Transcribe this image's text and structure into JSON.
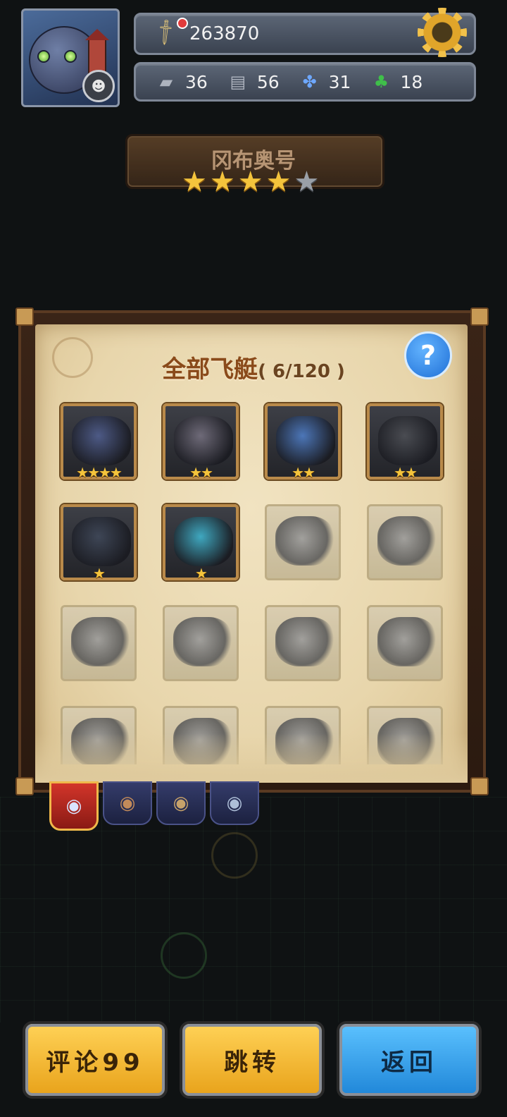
{
  "header": {
    "power_value": "263870",
    "resources": [
      {
        "icon": "tank-icon",
        "value": "36"
      },
      {
        "icon": "armor-plate-icon",
        "value": "56"
      },
      {
        "icon": "propeller-icon",
        "value": "31"
      },
      {
        "icon": "clover-icon",
        "value": "18"
      }
    ],
    "avatar_rank_icon": "monkey-icon"
  },
  "selected_ship": {
    "name": "冈布奥号",
    "stars_filled": 4,
    "stars_total": 5
  },
  "panel": {
    "title": "全部飞艇",
    "count": "( 6/120 )",
    "help_label": "?"
  },
  "ships": [
    {
      "owned": true,
      "stars": "★★★★",
      "color": "#4d5a86"
    },
    {
      "owned": true,
      "stars": "★★",
      "color": "#6e6a78"
    },
    {
      "owned": true,
      "stars": "★★",
      "color": "#4c76b8"
    },
    {
      "owned": true,
      "stars": "★★",
      "color": "#4a4c52"
    },
    {
      "owned": true,
      "stars": "★",
      "color": "#3e4656"
    },
    {
      "owned": true,
      "stars": "★",
      "color": "#3fa8c0"
    },
    {
      "owned": false,
      "stars": ""
    },
    {
      "owned": false,
      "stars": ""
    },
    {
      "owned": false,
      "stars": ""
    },
    {
      "owned": false,
      "stars": ""
    },
    {
      "owned": false,
      "stars": ""
    },
    {
      "owned": false,
      "stars": ""
    },
    {
      "owned": false,
      "stars": ""
    },
    {
      "owned": false,
      "stars": ""
    },
    {
      "owned": false,
      "stars": ""
    },
    {
      "owned": false,
      "stars": ""
    }
  ],
  "tabs": [
    {
      "icon": "airship-red-icon",
      "active": true
    },
    {
      "icon": "airship-a-icon",
      "active": false
    },
    {
      "icon": "airship-b-icon",
      "active": false
    },
    {
      "icon": "airship-c-icon",
      "active": false
    }
  ],
  "buttons": {
    "comment": "评论99",
    "jump": "跳转",
    "back": "返回"
  }
}
